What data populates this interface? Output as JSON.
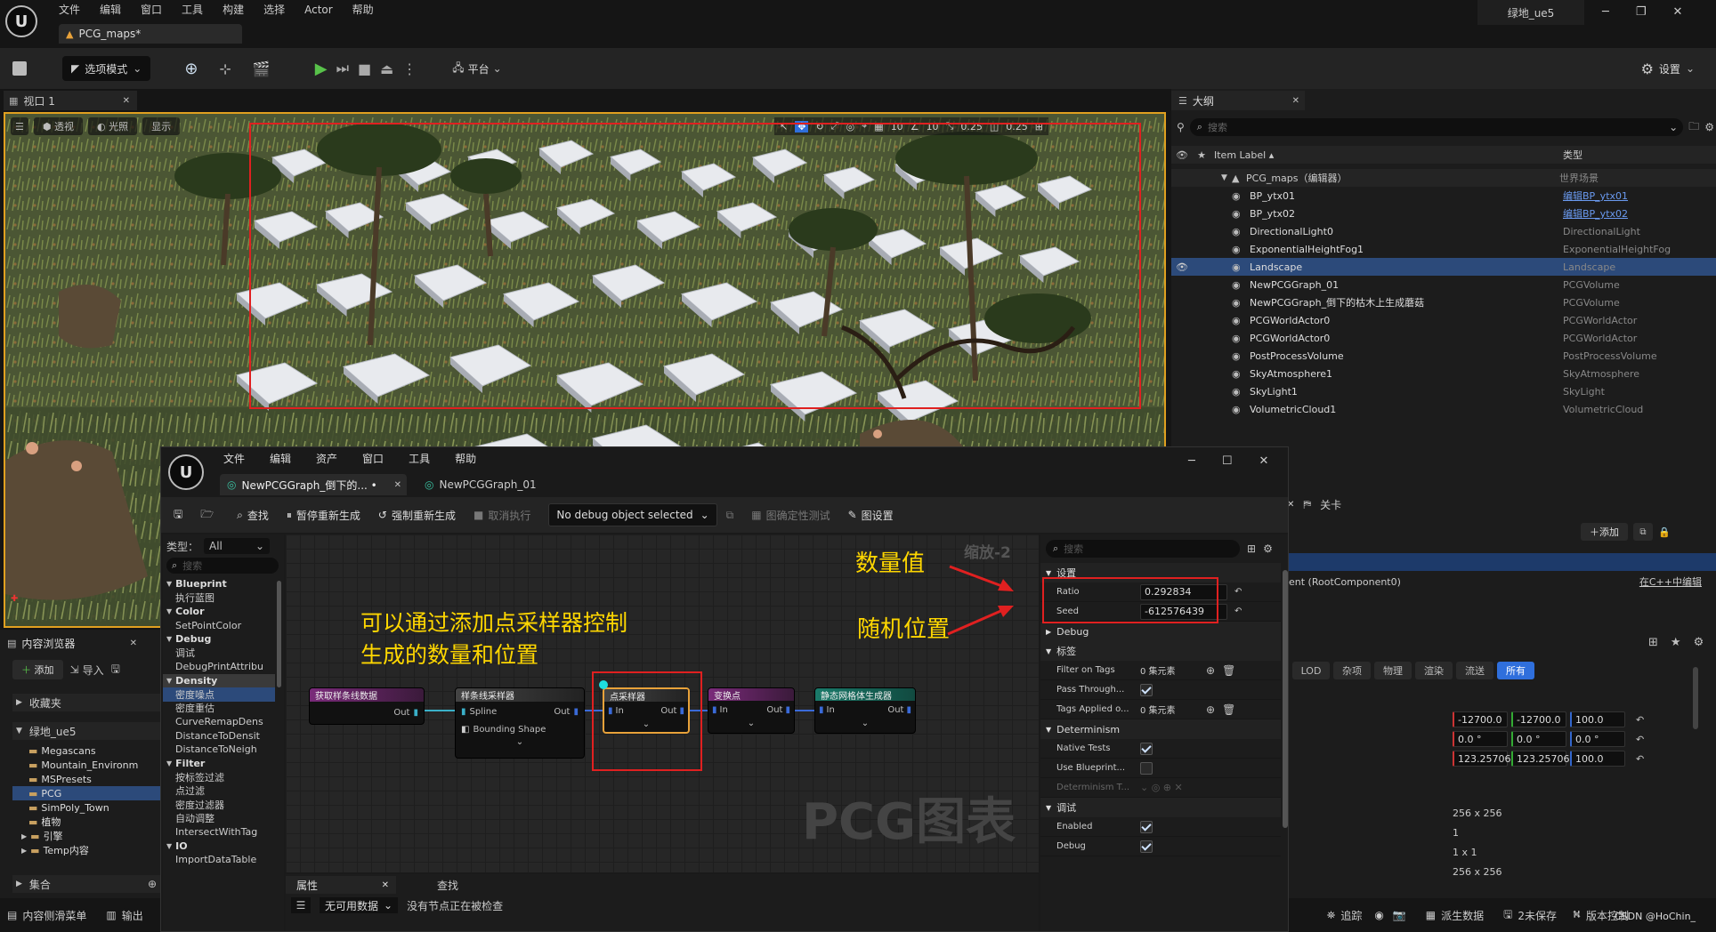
{
  "main_window": {
    "menu": [
      "文件",
      "编辑",
      "窗口",
      "工具",
      "构建",
      "选择",
      "Actor",
      "帮助"
    ],
    "project_name": "绿地_ue5",
    "tab_title": "PCG_maps*",
    "toolbar": {
      "mode_label": "选项模式",
      "platform_label": "平台",
      "settings_label": "设置"
    }
  },
  "viewport": {
    "tab_label": "视口 1",
    "buttons": [
      "透视",
      "光照",
      "显示"
    ],
    "grid_values": [
      "10",
      "10",
      "0.25",
      "0.25"
    ]
  },
  "outliner": {
    "tab_label": "大纲",
    "search_placeholder": "搜索",
    "col_label": "Item Label ▴",
    "col_type": "类型",
    "root": {
      "label": "PCG_maps（编辑器）",
      "type": "世界场景"
    },
    "items": [
      {
        "label": "BP_ytx01",
        "type": "编辑BP_ytx01",
        "link": true,
        "selected": false
      },
      {
        "label": "BP_ytx02",
        "type": "编辑BP_ytx02",
        "link": true,
        "selected": false
      },
      {
        "label": "DirectionalLight0",
        "type": "DirectionalLight",
        "link": false,
        "selected": false
      },
      {
        "label": "ExponentialHeightFog1",
        "type": "ExponentialHeightFog",
        "link": false,
        "selected": false
      },
      {
        "label": "Landscape",
        "type": "Landscape",
        "link": false,
        "selected": true
      },
      {
        "label": "NewPCGGraph_01",
        "type": "PCGVolume",
        "link": false,
        "selected": false
      },
      {
        "label": "NewPCGGraph_倒下的枯木上生成蘑菇",
        "type": "PCGVolume",
        "link": false,
        "selected": false
      },
      {
        "label": "PCGWorldActor0",
        "type": "PCGWorldActor",
        "link": false,
        "selected": false
      },
      {
        "label": "PCGWorldActor0",
        "type": "PCGWorldActor",
        "link": false,
        "selected": false
      },
      {
        "label": "PostProcessVolume",
        "type": "PostProcessVolume",
        "link": false,
        "selected": false
      },
      {
        "label": "SkyAtmosphere1",
        "type": "SkyAtmosphere",
        "link": false,
        "selected": false
      },
      {
        "label": "SkyLight1",
        "type": "SkyLight",
        "link": false,
        "selected": false
      },
      {
        "label": "VolumetricCloud1",
        "type": "VolumetricCloud",
        "link": false,
        "selected": false
      }
    ]
  },
  "details_bg": {
    "tab_level": "关卡",
    "add_label": "＋添加",
    "root_component": "ent (RootComponent0)",
    "cpp_link": "在C++中编辑",
    "filter_tabs": [
      "LOD",
      "杂项",
      "物理",
      "渲染",
      "流送",
      "所有"
    ],
    "vec1": [
      "-12700.0",
      "-12700.0",
      "100.0"
    ],
    "vec2": [
      "0.0 °",
      "0.0 °",
      "0.0 °"
    ],
    "vec3": [
      "123.257065",
      "123.257065",
      "100.0"
    ],
    "values": [
      "256 x 256",
      "1",
      "1 x 1",
      "256 x 256"
    ]
  },
  "status_bar": {
    "items": [
      "追踪",
      "派生数据",
      "2未保存",
      "版本控制"
    ],
    "watermark": "CSDN @HoChin_"
  },
  "content_browser": {
    "tab_label": "内容浏览器",
    "add_label": "添加",
    "import_label": "导入",
    "favorites": "收藏夹",
    "root": "绿地_ue5",
    "folders": [
      "Megascans",
      "Mountain_Environm",
      "MSPresets",
      "PCG",
      "SimPoly_Town",
      "植物",
      "引擎",
      "Temp内容"
    ],
    "collections": "集合",
    "drawer": "内容侧滑菜单",
    "output": "输出"
  },
  "pcg_window": {
    "menu": [
      "文件",
      "编辑",
      "资产",
      "窗口",
      "工具",
      "帮助"
    ],
    "tabs": [
      "NewPCGGraph_倒下的... •",
      "NewPCGGraph_01"
    ],
    "toolbar": {
      "find": "查找",
      "pause": "暂停重新生成",
      "force": "强制重新生成",
      "cancel": "取消执行",
      "debug_object": "No debug object selected",
      "determinism": "图确定性测试",
      "graph_settings": "图设置"
    },
    "palette": {
      "type_label": "类型：",
      "type_value": "All",
      "search_placeholder": "搜索",
      "items": [
        {
          "text": "Blueprint",
          "kind": "cat"
        },
        {
          "text": "执行蓝图",
          "kind": "item"
        },
        {
          "text": "Color",
          "kind": "cat"
        },
        {
          "text": "SetPointColor",
          "kind": "item"
        },
        {
          "text": "Debug",
          "kind": "cat"
        },
        {
          "text": "调试",
          "kind": "item"
        },
        {
          "text": "DebugPrintAttribu",
          "kind": "item"
        },
        {
          "text": "Density",
          "kind": "cat-sel"
        },
        {
          "text": "密度噪点",
          "kind": "item-sel"
        },
        {
          "text": "密度重估",
          "kind": "item"
        },
        {
          "text": "CurveRemapDens",
          "kind": "item"
        },
        {
          "text": "DistanceToDensit",
          "kind": "item"
        },
        {
          "text": "DistanceToNeigh",
          "kind": "item"
        },
        {
          "text": "Filter",
          "kind": "cat"
        },
        {
          "text": "按标签过滤",
          "kind": "item"
        },
        {
          "text": "点过滤",
          "kind": "item"
        },
        {
          "text": "密度过滤器",
          "kind": "item"
        },
        {
          "text": "自动调整",
          "kind": "item"
        },
        {
          "text": "IntersectWithTag",
          "kind": "item"
        },
        {
          "text": "IO",
          "kind": "cat"
        },
        {
          "text": "ImportDataTable",
          "kind": "item"
        }
      ]
    },
    "graph": {
      "zoom": "缩放-2",
      "watermark": "PCG图表",
      "annotation_main": [
        "可以通过添加点采样器控制",
        "生成的数量和位置"
      ],
      "annotation_count": "数量值",
      "annotation_seed": "随机位置",
      "nodes": {
        "get_spline": {
          "title": "获取样条线数据",
          "out": "Out"
        },
        "spline_sampler": {
          "title": "样条线采样器",
          "pin1": "Spline",
          "pin2": "Bounding Shape",
          "out": "Out"
        },
        "point_sampler": {
          "title": "点采样器",
          "in": "In",
          "out": "Out"
        },
        "transform": {
          "title": "变换点",
          "in": "In",
          "out": "Out"
        },
        "static_mesh": {
          "title": "静态网格体生成器",
          "in": "In",
          "out": "Out"
        }
      }
    },
    "bottom": {
      "tab_props": "属性",
      "tab_find": "查找",
      "no_data": "无可用数据",
      "no_node": "没有节点正在被检查"
    },
    "details": {
      "search_placeholder": "搜索",
      "sec_settings": "设置",
      "ratio_label": "Ratio",
      "ratio_value": "0.292834",
      "seed_label": "Seed",
      "seed_value": "-612576439",
      "sec_debug": "Debug",
      "sec_tags": "标签",
      "filter_on_tags": "Filter on Tags",
      "filter_on_tags_val": "0 集元素",
      "pass_through": "Pass Through...",
      "tags_applied": "Tags Applied o...",
      "tags_applied_val": "0 集元素",
      "sec_determinism": "Determinism",
      "native_tests": "Native Tests",
      "use_blueprint": "Use Blueprint...",
      "determinism_t": "Determinism T...",
      "sec_debug2": "调试",
      "enabled": "Enabled",
      "debug": "Debug"
    }
  },
  "colors": {
    "accent_blue": "#2f6fdc",
    "annotation_red": "#e02020",
    "annotation_yellow": "#ffd700",
    "node_orange": "#e8a23a"
  }
}
